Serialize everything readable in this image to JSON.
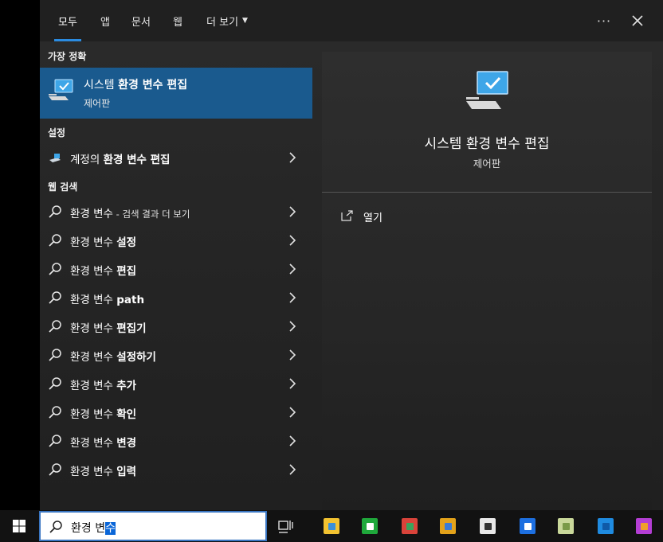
{
  "tabs": [
    {
      "label": "모두",
      "active": true
    },
    {
      "label": "앱",
      "active": false
    },
    {
      "label": "문서",
      "active": false
    },
    {
      "label": "웹",
      "active": false
    },
    {
      "label": "더 보기",
      "active": false
    }
  ],
  "header": {
    "more_options_label": "···",
    "close_icon": "close-icon"
  },
  "sections": {
    "best_match": "가장 정확",
    "settings": "설정",
    "web_search": "웹 검색"
  },
  "best_match": {
    "title_plain": "시스템 ",
    "title_bold": "환경 변수 편집",
    "subtitle": "제어판",
    "icon": "monitor-check-icon"
  },
  "settings_item": {
    "prefix": "계정의 ",
    "bold": "환경 변수 편집",
    "icon": "account-settings-icon"
  },
  "web_items": [
    {
      "plain": "환경 변수",
      "bold": "",
      "suffix": " - 검색 결과 더 보기"
    },
    {
      "plain": "환경 변수 ",
      "bold": "설정",
      "suffix": ""
    },
    {
      "plain": "환경 변수 ",
      "bold": "편집",
      "suffix": ""
    },
    {
      "plain": "환경 변수 ",
      "bold": "path",
      "suffix": ""
    },
    {
      "plain": "환경 변수 ",
      "bold": "편집기",
      "suffix": ""
    },
    {
      "plain": "환경 변수 ",
      "bold": "설정하기",
      "suffix": ""
    },
    {
      "plain": "환경 변수 ",
      "bold": "추가",
      "suffix": ""
    },
    {
      "plain": "환경 변수 ",
      "bold": "확인",
      "suffix": ""
    },
    {
      "plain": "환경 변수 ",
      "bold": "변경",
      "suffix": ""
    },
    {
      "plain": "환경 변수 ",
      "bold": "입력",
      "suffix": ""
    }
  ],
  "preview": {
    "title": "시스템 환경 변수 편집",
    "subtitle": "제어판",
    "open_label": "열기"
  },
  "search": {
    "query_plain": "환경 변",
    "query_selected": "수"
  },
  "taskbar": {
    "apps": [
      "file-explorer-icon",
      "green-app-icon",
      "chrome-canary-icon",
      "chrome-icon",
      "notepad-app-icon",
      "blue-app-icon",
      "paint-app-icon",
      "vscode-icon",
      "colorful-app-icon"
    ]
  },
  "colors": {
    "accent": "#2b8be0",
    "best_match_bg": "#1a5a8e",
    "panel_bg": "#2b2b2b"
  }
}
